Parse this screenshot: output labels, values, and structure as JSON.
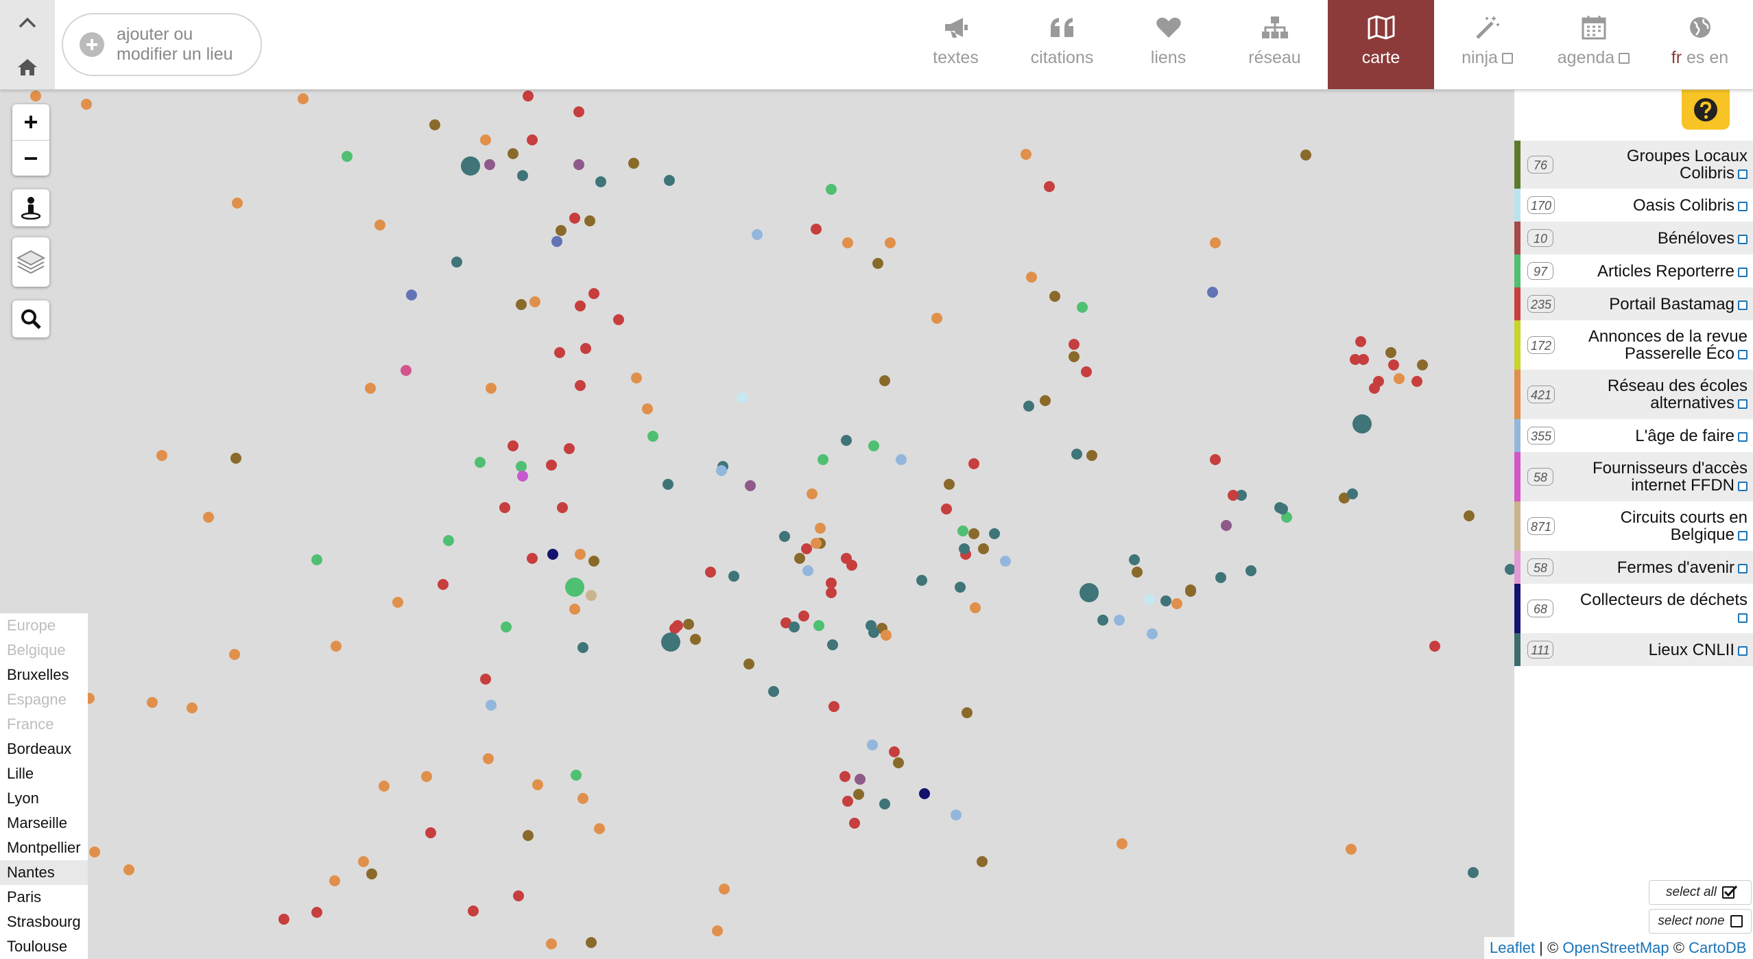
{
  "header": {
    "add_place_label": "ajouter ou modifier un lieu",
    "nav": [
      {
        "label": "textes",
        "icon": "megaphone-icon",
        "external": false,
        "active": false
      },
      {
        "label": "citations",
        "icon": "quote-icon",
        "external": false,
        "active": false
      },
      {
        "label": "liens",
        "icon": "heart-icon",
        "external": false,
        "active": false
      },
      {
        "label": "réseau",
        "icon": "network-icon",
        "external": false,
        "active": false
      },
      {
        "label": "carte",
        "icon": "map-icon",
        "external": false,
        "active": true
      },
      {
        "label": "ninja",
        "icon": "magic-wand-icon",
        "external": true,
        "active": false
      },
      {
        "label": "agenda",
        "icon": "calendar-icon",
        "external": true,
        "active": false
      }
    ],
    "languages": {
      "current": "fr",
      "others": "es en"
    }
  },
  "map": {
    "zoom_in": "+",
    "zoom_out": "−",
    "cities": [
      {
        "name": "Europe",
        "dim": true,
        "selected": false
      },
      {
        "name": "Belgique",
        "dim": true,
        "selected": false
      },
      {
        "name": "Bruxelles",
        "dim": false,
        "selected": false
      },
      {
        "name": "Espagne",
        "dim": true,
        "selected": false
      },
      {
        "name": "France",
        "dim": true,
        "selected": false
      },
      {
        "name": "Bordeaux",
        "dim": false,
        "selected": false
      },
      {
        "name": "Lille",
        "dim": false,
        "selected": false
      },
      {
        "name": "Lyon",
        "dim": false,
        "selected": false
      },
      {
        "name": "Marseille",
        "dim": false,
        "selected": false
      },
      {
        "name": "Montpellier",
        "dim": false,
        "selected": false
      },
      {
        "name": "Nantes",
        "dim": false,
        "selected": true
      },
      {
        "name": "Paris",
        "dim": false,
        "selected": false
      },
      {
        "name": "Strasbourg",
        "dim": false,
        "selected": false
      },
      {
        "name": "Toulouse",
        "dim": false,
        "selected": false
      }
    ],
    "attribution": {
      "leaflet": "Leaflet",
      "sep1": " | © ",
      "osm": "OpenStreetMap",
      "sep2": " © ",
      "carto": "CartoDB"
    }
  },
  "panel": {
    "layers": [
      {
        "count": "76",
        "name": "Groupes Locaux Colibris",
        "color": "#5c7a2e"
      },
      {
        "count": "170",
        "name": "Oasis Colibris",
        "color": "#b9e3ef"
      },
      {
        "count": "10",
        "name": "Bénéloves",
        "color": "#a54a4a"
      },
      {
        "count": "97",
        "name": "Articles Reporterre",
        "color": "#4fbf72"
      },
      {
        "count": "235",
        "name": "Portail Bastamag",
        "color": "#c73e3e"
      },
      {
        "count": "172",
        "name": "Annonces de la revue Passerelle Éco",
        "color": "#c8d42c"
      },
      {
        "count": "421",
        "name": "Réseau des écoles alternatives",
        "color": "#e0904a"
      },
      {
        "count": "355",
        "name": "L'âge de faire",
        "color": "#93b7dc"
      },
      {
        "count": "58",
        "name": "Fournisseurs d'accès internet FFDN",
        "color": "#d455c8"
      },
      {
        "count": "871",
        "name": "Circuits courts en Belgique",
        "color": "#c9b48e"
      },
      {
        "count": "58",
        "name": "Fermes d'avenir",
        "color": "#e39ad4"
      },
      {
        "count": "68",
        "name": "Collecteurs de déchets",
        "color": "#13136e"
      },
      {
        "count": "111",
        "name": "Lieux CNLII",
        "color": "#3b6d6d"
      }
    ],
    "select_all": "select all",
    "select_none": "select none"
  },
  "palette": {
    "orange": "#e0904a",
    "red": "#c73e3e",
    "olive": "#8a6a2a",
    "teal": "#3f7478",
    "green": "#4fbf72",
    "lightblue": "#93b7dc",
    "blue": "#6373b8",
    "purple": "#8e5a8a",
    "pink": "#d4558e",
    "navy": "#13136e",
    "tan": "#c9b48e",
    "magenta": "#c85ad0",
    "cyan": "#c6e8f2",
    "brand": "#8c3a3a",
    "help": "#f7c325"
  }
}
